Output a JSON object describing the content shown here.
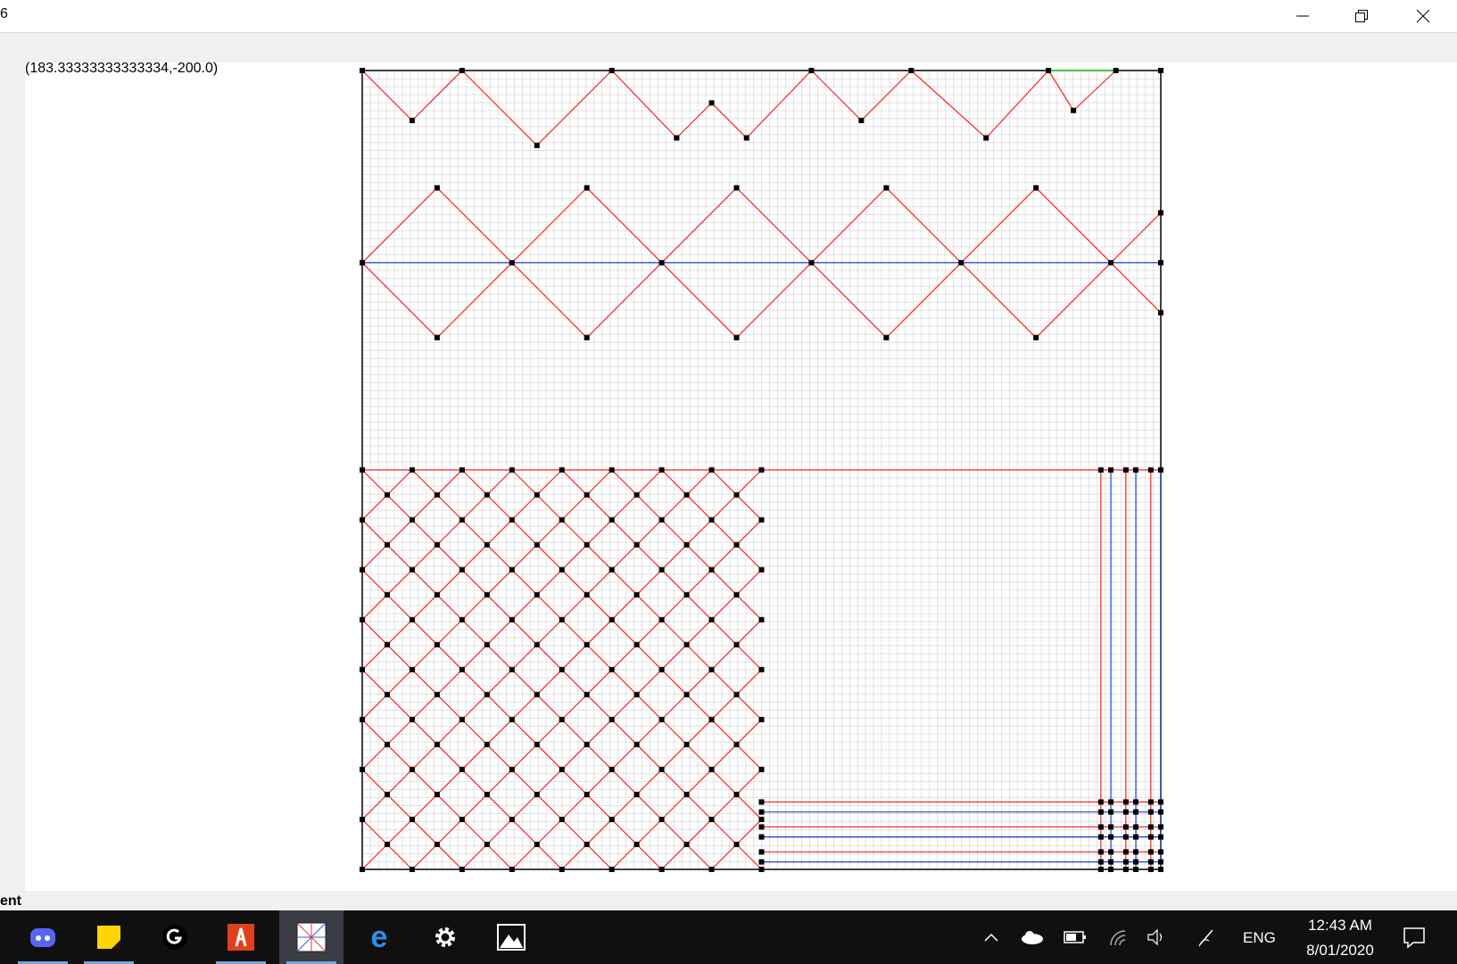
{
  "window": {
    "title": "6",
    "controls": {
      "minimize_icon": "minimize-icon",
      "restore_icon": "restore-icon",
      "close_icon": "close-icon"
    }
  },
  "canvas": {
    "coordinate_readout": "(183.33333333333334,-200.0)",
    "colors": {
      "grid": "#c8c8c8",
      "border": "#000000",
      "red_path": "#ff2020",
      "blue_path": "#1f3fd6",
      "green_path": "#2ee82e",
      "vertex": "#000000"
    }
  },
  "status": {
    "text": "ent"
  },
  "taskbar": {
    "apps": [
      {
        "name": "Discord",
        "icon": "discord-icon",
        "color": "#5865f2",
        "pinned_open": true
      },
      {
        "name": "Sticky Notes",
        "icon": "sticky-notes-icon",
        "color": "#ffd400",
        "pinned_open": true
      },
      {
        "name": "Logitech G HUB",
        "icon": "logitech-g-icon",
        "color": "#ffffff",
        "pinned_open": false
      },
      {
        "name": "Acrobat",
        "icon": "acrobat-icon",
        "color": "#e2401c",
        "pinned_open": true
      },
      {
        "name": "Crease Pattern Viewer",
        "icon": "crease-pattern-icon",
        "color": "#6b8fd6",
        "pinned_open": true
      },
      {
        "name": "Edge",
        "icon": "edge-icon",
        "color": "#2c8ee8",
        "pinned_open": false
      },
      {
        "name": "Settings",
        "icon": "gear-icon",
        "color": "#ffffff",
        "pinned_open": false
      },
      {
        "name": "Photos",
        "icon": "photos-icon",
        "color": "#ffffff",
        "pinned_open": false
      }
    ],
    "tray": {
      "icons": [
        "chevron-up-icon",
        "onedrive-icon",
        "battery-icon",
        "wifi-icon",
        "volume-icon",
        "pen-icon"
      ],
      "language": "ENG",
      "time": "12:43 AM",
      "date": "8/01/2020",
      "notification_icon": "notification-icon"
    }
  }
}
